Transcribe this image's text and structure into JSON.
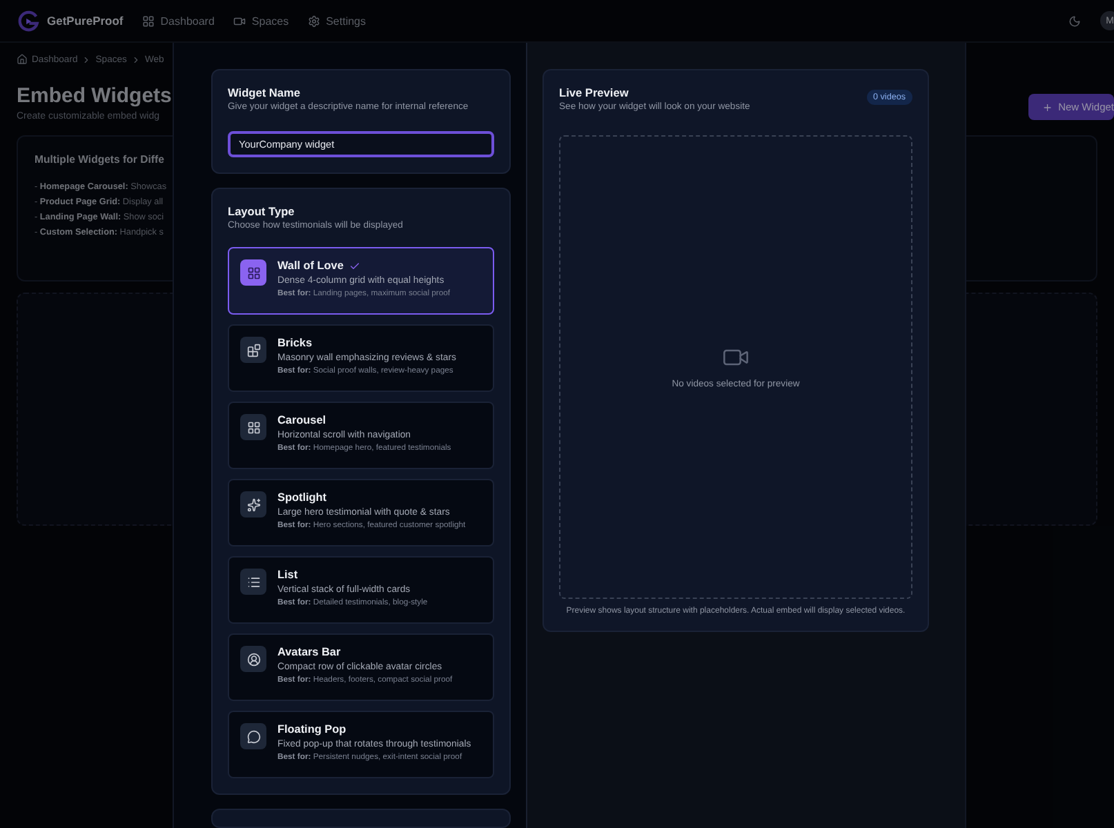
{
  "app": {
    "brand": "GetPureProof",
    "nav": [
      {
        "label": "Dashboard",
        "kind": "grid"
      },
      {
        "label": "Spaces",
        "kind": "video"
      },
      {
        "label": "Settings",
        "kind": "gear"
      }
    ],
    "avatar": "M"
  },
  "breadcrumb": [
    "Dashboard",
    "Spaces",
    "Web"
  ],
  "page": {
    "title": "Embed Widgets",
    "subtitle": "Create customizable embed widg",
    "new_button": "New Widget"
  },
  "info_card": {
    "title": "Multiple Widgets for Diffe",
    "items": [
      "- **Homepage Carousel:** Showcas",
      "- **Product Page Grid:** Display all",
      "- **Landing Page Wall:** Show soci",
      "- **Custom Selection:** Handpick s"
    ]
  },
  "modal": {
    "name_section": {
      "title": "Widget Name",
      "subtitle": "Give your widget a descriptive name for internal reference",
      "value": "YourCompany widget"
    },
    "layout_section": {
      "title": "Layout Type",
      "subtitle": "Choose how testimonials will be displayed",
      "layouts": [
        {
          "name": "Wall of Love",
          "kind": "grid",
          "description": "Dense 4-column grid with equal heights",
          "best_for": "**Best for:** Landing pages, maximum social proof",
          "selected": true
        },
        {
          "name": "Bricks",
          "kind": "blocks",
          "description": "Masonry wall emphasizing reviews & stars",
          "best_for": "**Best for:** Social proof walls, review-heavy pages",
          "selected": false
        },
        {
          "name": "Carousel",
          "kind": "grid",
          "description": "Horizontal scroll with navigation",
          "best_for": "**Best for:** Homepage hero, featured testimonials",
          "selected": false
        },
        {
          "name": "Spotlight",
          "kind": "sparkles",
          "description": "Large hero testimonial with quote & stars",
          "best_for": "**Best for:** Hero sections, featured customer spotlight",
          "selected": false
        },
        {
          "name": "List",
          "kind": "list",
          "description": "Vertical stack of full-width cards",
          "best_for": "**Best for:** Detailed testimonials, blog-style",
          "selected": false
        },
        {
          "name": "Avatars Bar",
          "kind": "user",
          "description": "Compact row of clickable avatar circles",
          "best_for": "**Best for:** Headers, footers, compact social proof",
          "selected": false
        },
        {
          "name": "Floating Pop",
          "kind": "chat",
          "description": "Fixed pop-up that rotates through testimonials",
          "best_for": "**Best for:** Persistent nudges, exit-intent social proof",
          "selected": false
        }
      ]
    },
    "preview": {
      "title": "Live Preview",
      "subtitle": "See how your widget will look on your website",
      "badge": "0 videos",
      "empty": "No videos selected for preview",
      "footer": "Preview shows layout structure with placeholders. Actual embed will display selected videos."
    }
  }
}
